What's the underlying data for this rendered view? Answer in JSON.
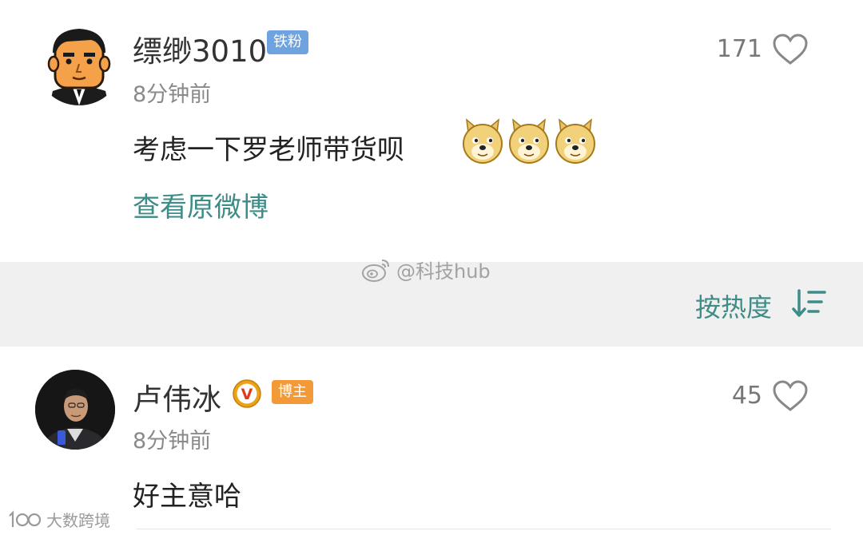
{
  "comments": [
    {
      "username": "缥缈3010",
      "badge": "铁粉",
      "time": "8分钟前",
      "likes": "171",
      "content": "考虑一下罗老师带货呗",
      "emoji_count": 3,
      "view_original": "查看原微博"
    },
    {
      "username": "卢伟冰",
      "verified_mark": "V",
      "badge": "博主",
      "time": "8分钟前",
      "likes": "45",
      "content": "好主意哈"
    }
  ],
  "sort_bar": {
    "label": "按热度"
  },
  "watermarks": {
    "weibo": "@科技hub",
    "corner": "大数跨境"
  },
  "colors": {
    "accent_teal": "#3d8c87",
    "fan_badge": "#6fa3e0",
    "blogger_badge": "#f29a38",
    "verified": "#e8a317",
    "sort_bar_bg": "#f0f0f0"
  }
}
